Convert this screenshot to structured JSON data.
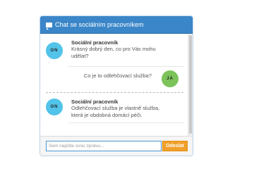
{
  "header": {
    "title": "Chat se sociálním pracovníkem",
    "icon": "chat-bubble-icon"
  },
  "messages": [
    {
      "sender": "Sociální pracovník",
      "avatar": "ON",
      "lines": [
        "Krásný dobrý den, co pro Vás mohu",
        "udělat?"
      ]
    },
    {
      "sender": "",
      "avatar": "JA",
      "lines": [
        "Co je to odlehčovací služba?"
      ]
    },
    {
      "sender": "Sociální pracovník",
      "avatar": "ON",
      "lines": [
        "Odlehčovací služba je vlastně služba,",
        "která je obdobná domácí péči."
      ]
    }
  ],
  "footer": {
    "input_placeholder": "Sem napište svou zprávu...",
    "send_label": "Odeslat"
  },
  "colors": {
    "header": "#3a86c8",
    "avatar_other": "#52c3e9",
    "avatar_me": "#7cc35a",
    "send_button": "#f0a12b"
  }
}
